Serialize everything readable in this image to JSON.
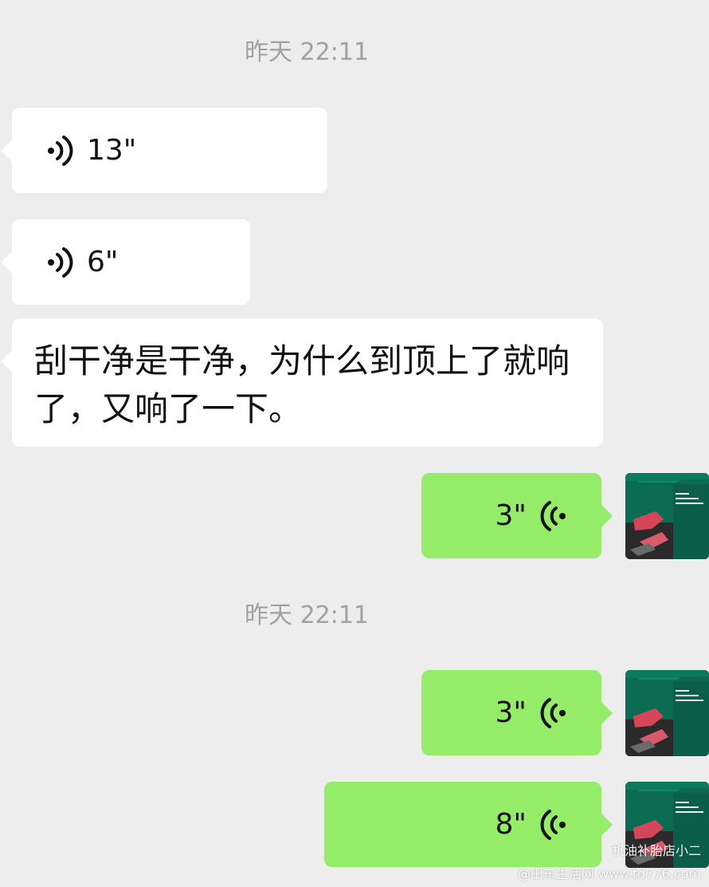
{
  "conversation": {
    "timestamps": [
      "昨天 22:11",
      "昨天 22:11"
    ],
    "messages": [
      {
        "side": "left",
        "type": "voice",
        "duration": "13\""
      },
      {
        "side": "left",
        "type": "voice",
        "duration": "6\""
      },
      {
        "side": "left",
        "type": "text",
        "text": "刮干净是干净，为什么到顶上了就响了，又响了一下。"
      },
      {
        "side": "right",
        "type": "voice",
        "duration": "3\""
      },
      {
        "side": "right",
        "type": "voice",
        "duration": "3\""
      },
      {
        "side": "right",
        "type": "voice",
        "duration": "8\""
      }
    ]
  },
  "avatar": {
    "name": "机油补胎店小二",
    "icon": "user-avatar-icon"
  },
  "watermark": {
    "site": "@田东生活网 www.td776.com",
    "name": "机油补胎店小二"
  },
  "colors": {
    "background": "#ededed",
    "incoming_bubble": "#ffffff",
    "outgoing_bubble": "#95ec69",
    "timestamp": "#a1a1a1"
  }
}
